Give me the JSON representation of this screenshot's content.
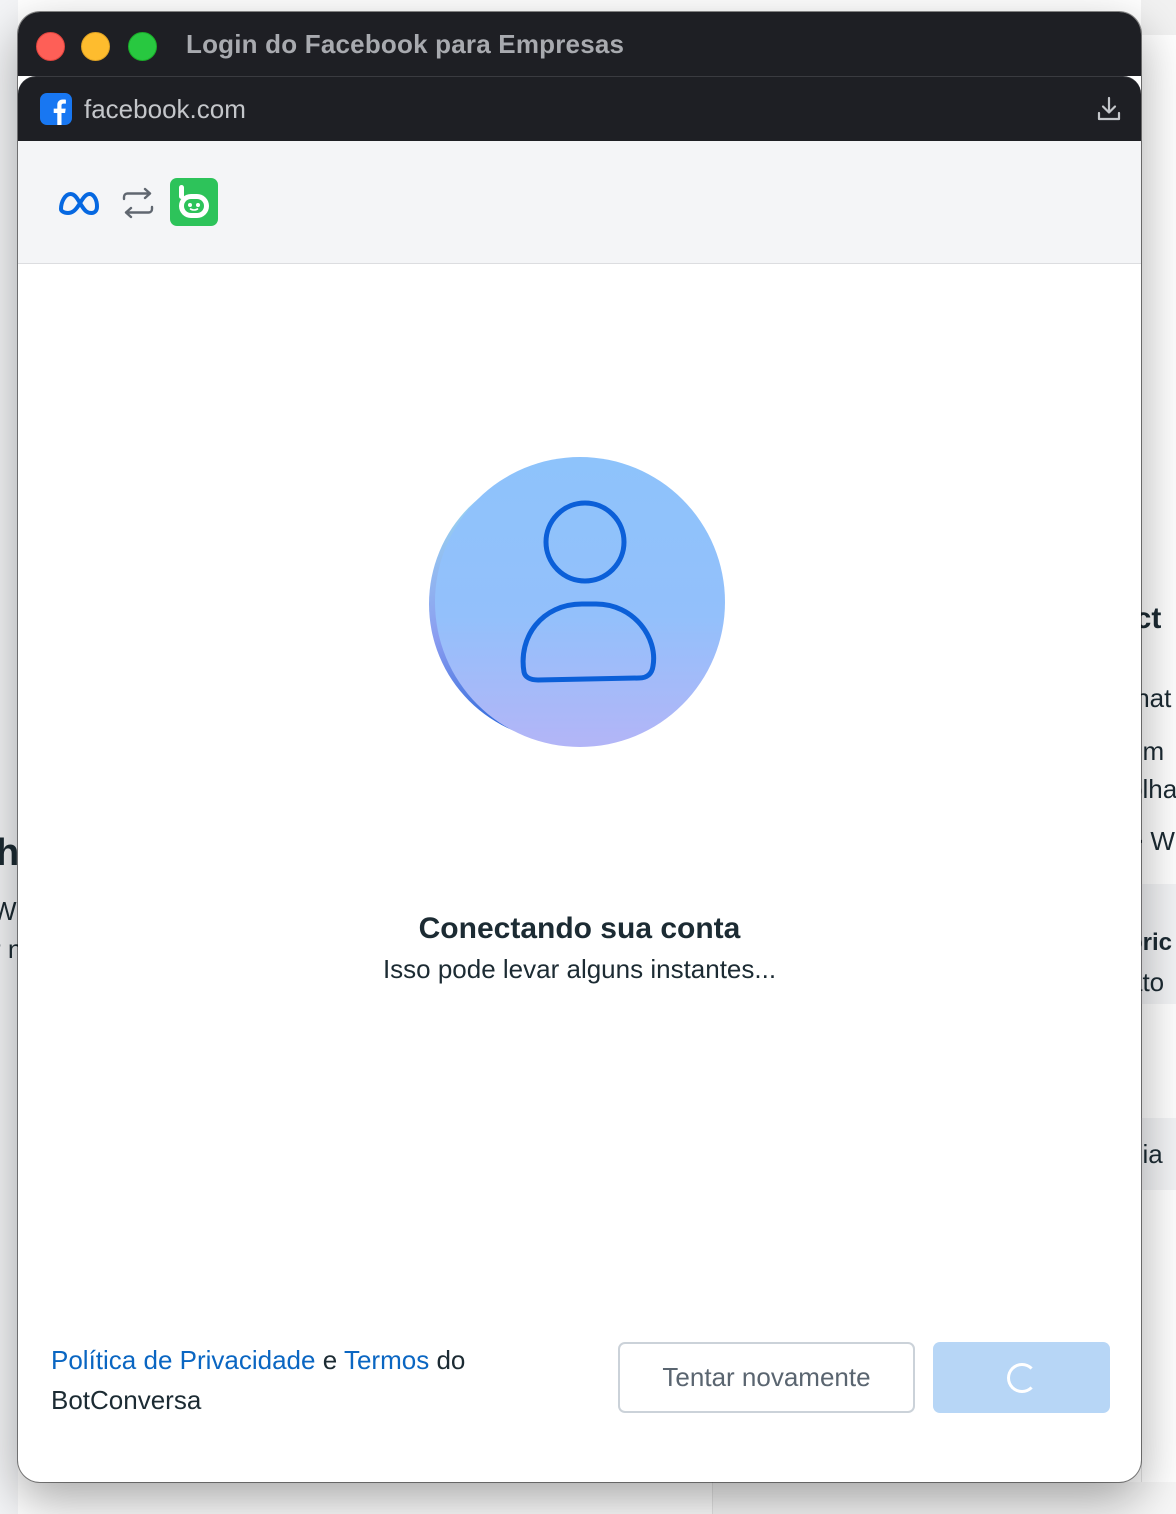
{
  "window": {
    "title": "Login do Facebook para Empresas",
    "url": "facebook.com"
  },
  "status": {
    "title": "Conectando sua conta",
    "subtitle": "Isso pode levar alguns instantes..."
  },
  "footer": {
    "privacy_link": "Política de Privacidade",
    "connector_and": "e",
    "terms_link": "Termos",
    "connector_of": "do",
    "app_name": "BotConversa"
  },
  "buttons": {
    "retry_label": "Tentar novamente"
  },
  "background_fragments": {
    "right_1": "ect",
    "right_2": "/hat",
    "right_3": "úm",
    "right_4": "olha",
    "right_5": "> W",
    "right_6": "oric",
    "right_7": "ato",
    "right_8": "uia",
    "left_1": "h",
    "left_2": "W",
    "left_3": "r n"
  },
  "colors": {
    "link": "#0a66c2",
    "primary_button_disabled": "#b7d6f6",
    "botconversa_green": "#2dc35a",
    "meta_blue": "#0668e1"
  },
  "icons": {
    "favicon": "facebook-icon",
    "download": "download-icon",
    "meta": "meta-logo-icon",
    "swap": "swap-arrows-icon",
    "app": "botconversa-logo-icon",
    "avatar": "user-avatar-icon",
    "loading": "spinner-icon"
  }
}
